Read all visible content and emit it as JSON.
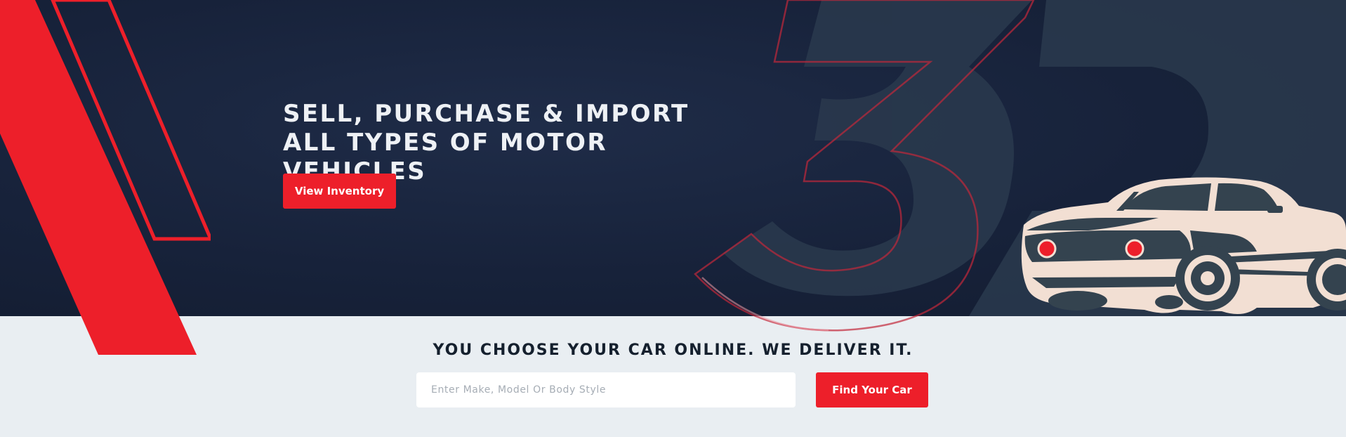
{
  "hero": {
    "headline": "SELL, PURCHASE & IMPORT ALL TYPES OF MOTOR VEHICLES",
    "view_inventory_label": "View Inventory"
  },
  "search": {
    "tagline": "YOU CHOOSE YOUR CAR ONLINE. WE DELIVER IT.",
    "placeholder": "Enter Make, Model Or Body Style",
    "value": "",
    "find_label": "Find Your Car"
  },
  "colors": {
    "brand_red": "#ed1f2a",
    "hero_navy": "#17223a",
    "lower_bg": "#e9eef2",
    "car_cream": "#f2dfd3",
    "car_slate": "#34434f"
  },
  "icons": {
    "brand_mark": "3d-logo-watermark",
    "car": "muscle-car-illustration"
  }
}
